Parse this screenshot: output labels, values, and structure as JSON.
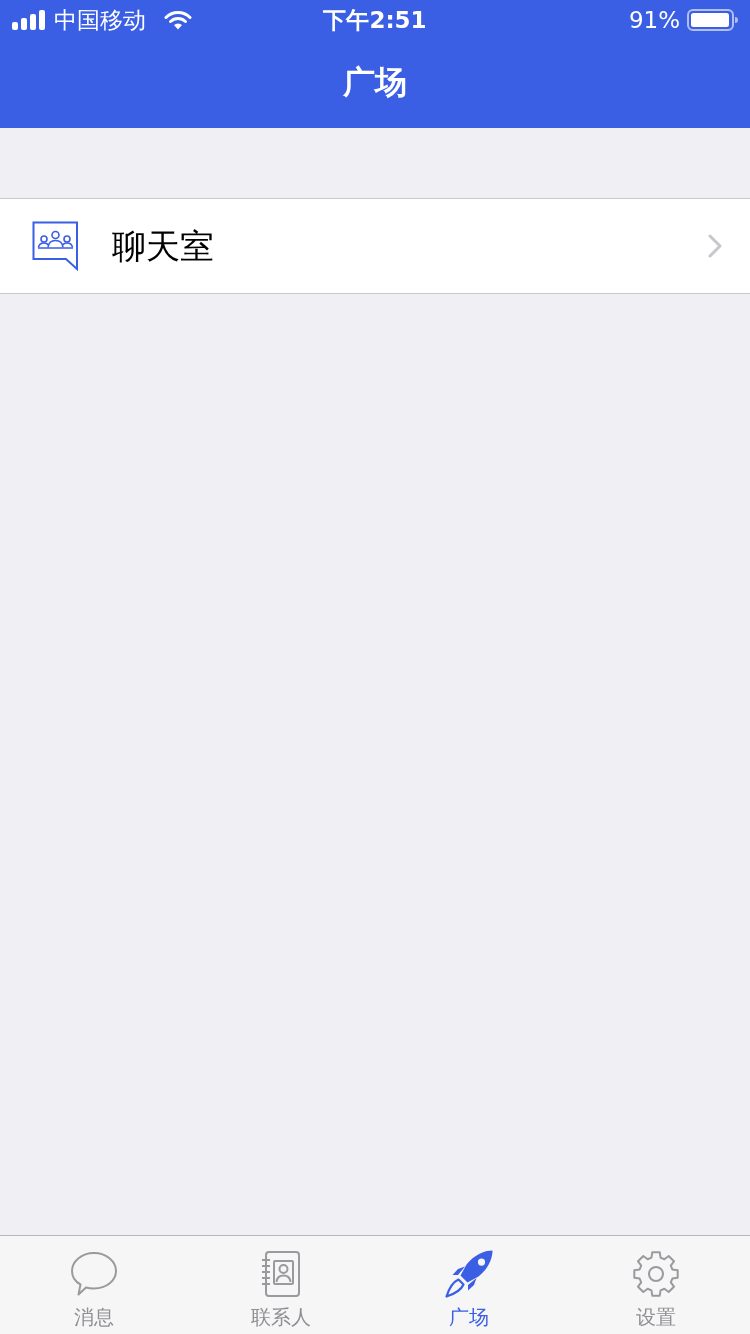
{
  "status_bar": {
    "carrier": "中国移动",
    "time": "下午2:51",
    "battery": "91%"
  },
  "nav_bar": {
    "title": "广场"
  },
  "list": [
    {
      "label": "聊天室"
    }
  ],
  "tab_bar": [
    {
      "label": "消息",
      "selected": false
    },
    {
      "label": "联系人",
      "selected": false
    },
    {
      "label": "广场",
      "selected": true
    },
    {
      "label": "设置",
      "selected": false
    }
  ]
}
